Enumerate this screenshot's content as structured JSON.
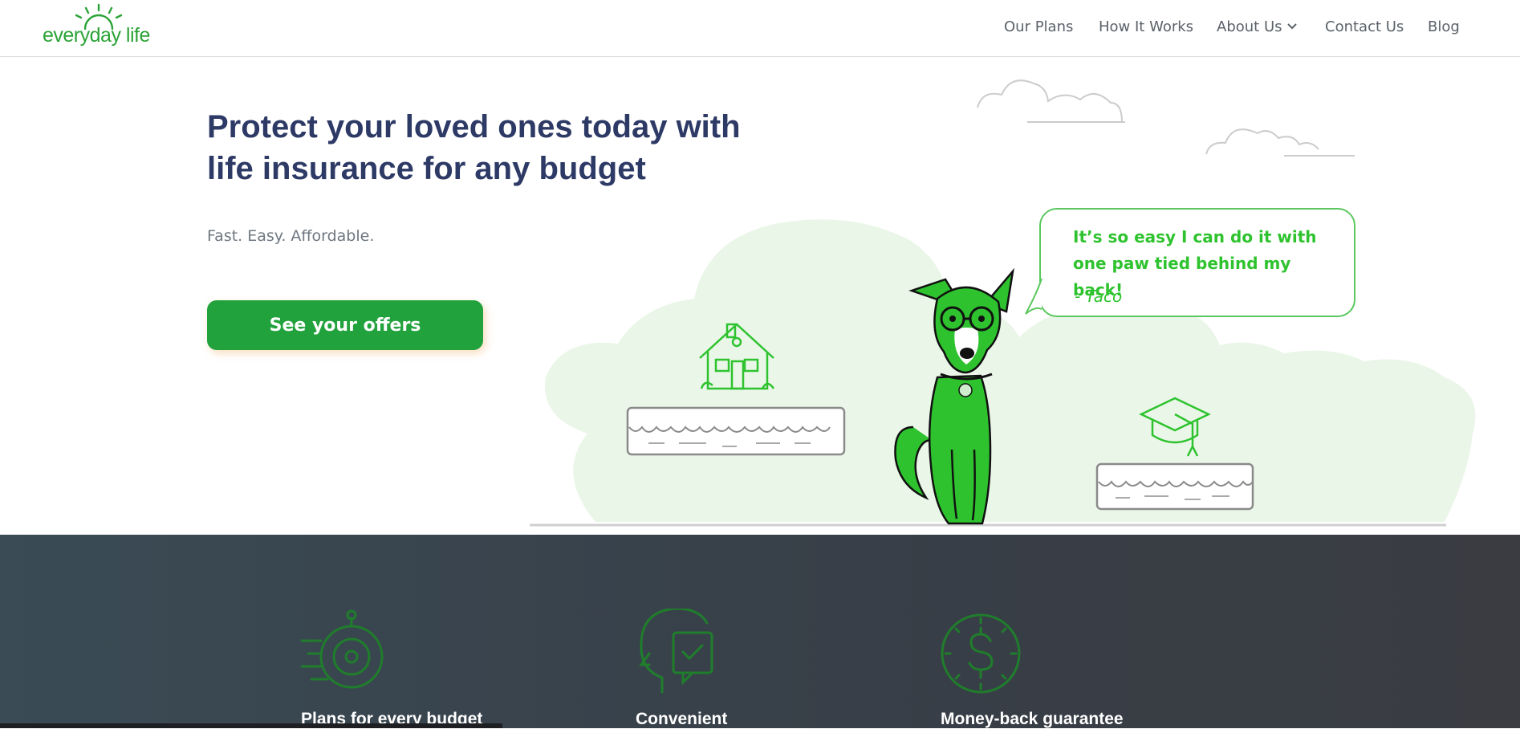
{
  "brand": {
    "logo_word_1": "everyday",
    "logo_word_2": " life",
    "color": "#2ba336"
  },
  "nav": {
    "items": [
      {
        "label": "Our Plans"
      },
      {
        "label": "How It Works"
      },
      {
        "label": "About Us",
        "has_dropdown": true
      },
      {
        "label": "Contact Us"
      },
      {
        "label": "Blog"
      }
    ]
  },
  "hero": {
    "headline_line_1": "Protect your loved ones today with",
    "headline_line_2": "life insurance for any budget",
    "subline": "Fast. Easy. Affordable.",
    "cta_label": "See your offers",
    "cta_color": "#21a23c"
  },
  "testimonial": {
    "quote": "It’s so easy I can do it with one paw tied behind my back!",
    "author": "- Taco"
  },
  "features": {
    "items": [
      {
        "label": "Plans for every budget",
        "icon": "stopwatch-target-icon"
      },
      {
        "label": "Convenient",
        "icon": "head-clock-icon"
      },
      {
        "label": "Money-back guarantee",
        "icon": "dollar-clock-icon"
      }
    ]
  },
  "colors": {
    "headline": "#2e3a66",
    "accent_green": "#2ec32e",
    "band": "#383f48"
  }
}
